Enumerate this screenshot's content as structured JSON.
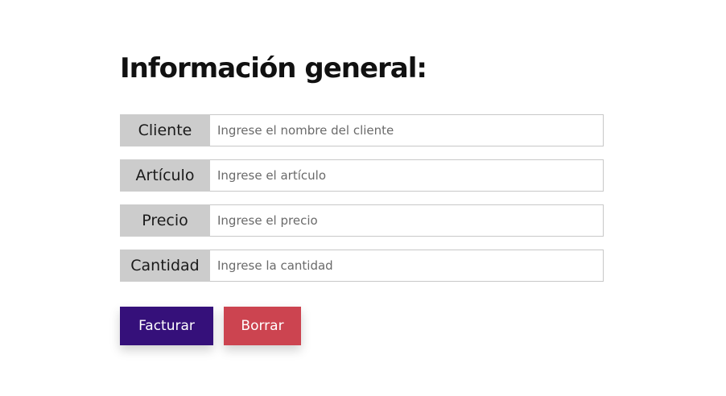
{
  "form": {
    "title": "Información general:",
    "fields": [
      {
        "label": "Cliente",
        "placeholder": "Ingrese el nombre del cliente",
        "value": ""
      },
      {
        "label": "Artículo",
        "placeholder": "Ingrese el artículo",
        "value": ""
      },
      {
        "label": "Precio",
        "placeholder": "Ingrese el precio",
        "value": ""
      },
      {
        "label": "Cantidad",
        "placeholder": "Ingrese la cantidad",
        "value": ""
      }
    ],
    "buttons": {
      "submit_label": "Facturar",
      "clear_label": "Borrar"
    }
  },
  "colors": {
    "primary_button": "#35107a",
    "danger_button": "#cc4450",
    "label_background": "#cccccc",
    "input_border": "#c8c8c8"
  }
}
